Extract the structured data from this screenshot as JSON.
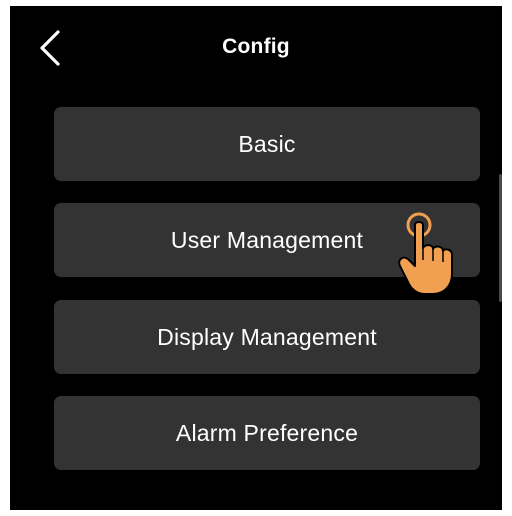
{
  "header": {
    "title": "Config",
    "back_icon": "chevron-left-icon"
  },
  "menu": {
    "items": [
      {
        "label": "Basic"
      },
      {
        "label": "User Management"
      },
      {
        "label": "Display Management"
      },
      {
        "label": "Alarm Preference"
      }
    ]
  },
  "overlay": {
    "pointer_icon": "tap-hand-icon",
    "pointer_color": "#F0A050"
  },
  "colors": {
    "background": "#000000",
    "button": "#333333",
    "text": "#ffffff"
  }
}
